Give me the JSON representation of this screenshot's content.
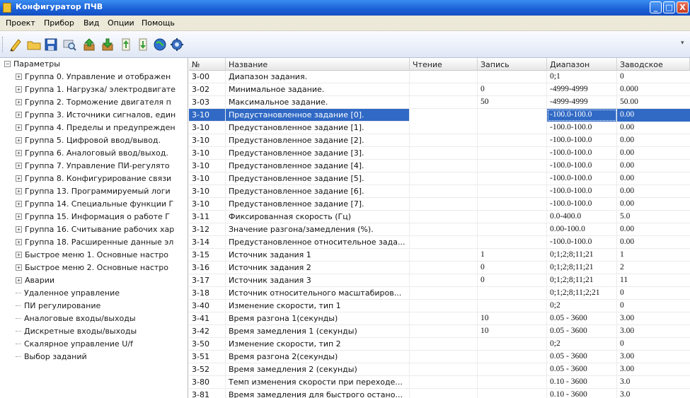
{
  "window": {
    "title": "Конфигуратор ПЧВ",
    "buttons": {
      "minimize": "_",
      "maximize": "□",
      "close": "X"
    }
  },
  "menu": [
    "Проект",
    "Прибор",
    "Вид",
    "Опции",
    "Помощь"
  ],
  "toolbar": {
    "icons": [
      "new-file-icon",
      "open-folder-icon",
      "save-icon",
      "search-device-icon",
      "upload-icon",
      "download-icon",
      "move-up-icon",
      "move-down-icon",
      "globe-icon",
      "settings-gear-icon"
    ],
    "overflow": "▾"
  },
  "tree": {
    "root": "Параметры",
    "root_state": "−",
    "groups": [
      "Группа 0. Управление и отображен",
      "Группа 1. Нагрузка/ электродвигате",
      "Группа 2. Торможение двигателя п",
      "Группа 3. Источники сигналов, един",
      "Группа 4. Пределы и предупрежден",
      "Группа 5. Цифровой ввод/вывод.",
      "Группа 6. Аналоговый ввод/выход.",
      "Группа 7. Управление ПИ-регулято",
      "Группа 8. Конфигурирование связи",
      "Группа 13. Программируемый логи",
      "Группа 14. Специальные функции Г",
      "Группа 15. Информация о работе Г",
      "Группа 16. Считывание рабочих хар",
      "Группа 18. Расширенные данные эл",
      "Быстрое меню 1. Основные настро",
      "Быстрое меню 2. Основные настро",
      "Аварии"
    ],
    "group_state": "+",
    "leaves": [
      "Удаленное управление",
      "ПИ регулирование",
      "Аналоговые входы/выходы",
      "Дискретные входы/выходы",
      "Скалярное управление U/f",
      "Выбор заданий"
    ]
  },
  "table": {
    "columns": [
      "№",
      "Название",
      "Чтение",
      "Запись",
      "Диапазон",
      "Заводское"
    ],
    "selected_row": 3,
    "rows": [
      [
        "3-00",
        "Диапазон задания.",
        "",
        "",
        "0;1",
        "0"
      ],
      [
        "3-02",
        "Минимальное задание.",
        "",
        "0",
        "-4999-4999",
        "0.000"
      ],
      [
        "3-03",
        "Максимальное задание.",
        "",
        "50",
        "-4999-4999",
        "50.00"
      ],
      [
        "3-10",
        "Предустановленное задание [0].",
        "",
        "",
        "-100.0-100.0",
        "0.00"
      ],
      [
        "3-10",
        "Предустановленное задание [1].",
        "",
        "",
        "-100.0-100.0",
        "0.00"
      ],
      [
        "3-10",
        "Предустановленное задание [2].",
        "",
        "",
        "-100.0-100.0",
        "0.00"
      ],
      [
        "3-10",
        "Предустановленное задание [3].",
        "",
        "",
        "-100.0-100.0",
        "0.00"
      ],
      [
        "3-10",
        "Предустановленное задание [4].",
        "",
        "",
        "-100.0-100.0",
        "0.00"
      ],
      [
        "3-10",
        "Предустановленное задание [5].",
        "",
        "",
        "-100.0-100.0",
        "0.00"
      ],
      [
        "3-10",
        "Предустановленное задание [6].",
        "",
        "",
        "-100.0-100.0",
        "0.00"
      ],
      [
        "3-10",
        "Предустановленное задание [7].",
        "",
        "",
        "-100.0-100.0",
        "0.00"
      ],
      [
        "3-11",
        "Фиксированная скорость (Гц)",
        "",
        "",
        "0.0-400.0",
        "5.0"
      ],
      [
        "3-12",
        "Значение разгона/замедления (%).",
        "",
        "",
        "0.00-100.0",
        "0.00"
      ],
      [
        "3-14",
        "Предустановленное относительное зада...",
        "",
        "",
        "-100.0-100.0",
        "0.00"
      ],
      [
        "3-15",
        "Источник задания 1",
        "",
        "1",
        "0;1;2;8;11;21",
        "1"
      ],
      [
        "3-16",
        "Источник задания 2",
        "",
        "0",
        "0;1;2;8;11;21",
        "2"
      ],
      [
        "3-17",
        "Источник задания 3",
        "",
        "0",
        "0;1;2;8;11;21",
        "11"
      ],
      [
        "3-18",
        "Источник относительного масштабиров...",
        "",
        "",
        "0;1;2;8;11;2;21",
        "0"
      ],
      [
        "3-40",
        "Изменение скорости, тип 1",
        "",
        "",
        "0;2",
        "0"
      ],
      [
        "3-41",
        "Время разгона 1(секунды)",
        "",
        "10",
        "0.05 - 3600",
        "3.00"
      ],
      [
        "3-42",
        "Время замедления 1 (секунды)",
        "",
        "10",
        "0.05 - 3600",
        "3.00"
      ],
      [
        "3-50",
        "Изменение скорости, тип 2",
        "",
        "",
        "0;2",
        "0"
      ],
      [
        "3-51",
        "Время разгона 2(секунды)",
        "",
        "",
        "0.05 - 3600",
        "3.00"
      ],
      [
        "3-52",
        "Время замедления 2 (секунды)",
        "",
        "",
        "0.05 - 3600",
        "3.00"
      ],
      [
        "3-80",
        "Темп изменения скорости при переходе...",
        "",
        "",
        "0.10 - 3600",
        "3.0"
      ],
      [
        "3-81",
        "Время замедления для быстрого остано...",
        "",
        "",
        "0.10 - 3600",
        "3.0"
      ]
    ]
  }
}
